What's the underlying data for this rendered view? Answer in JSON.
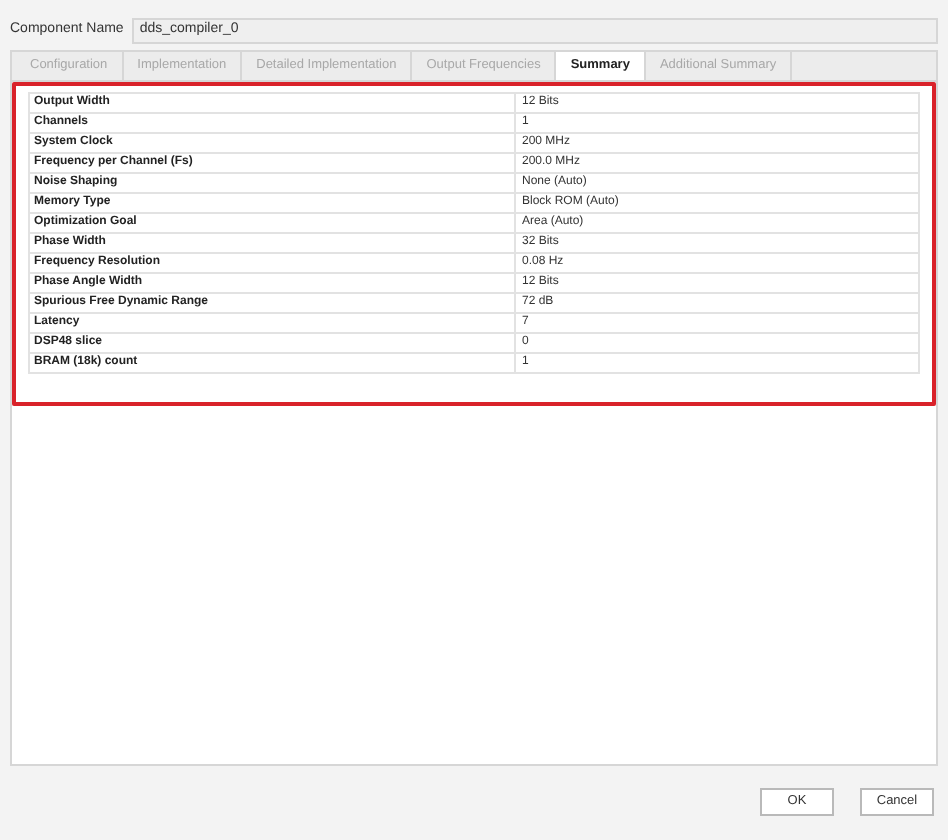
{
  "component_name": {
    "label": "Component Name",
    "value": "dds_compiler_0"
  },
  "tabs": [
    {
      "label": "Configuration",
      "selected": false
    },
    {
      "label": "Implementation",
      "selected": false
    },
    {
      "label": "Detailed Implementation",
      "selected": false
    },
    {
      "label": "Output Frequencies",
      "selected": false
    },
    {
      "label": "Summary",
      "selected": true
    },
    {
      "label": "Additional Summary",
      "selected": false
    }
  ],
  "summary_table": {
    "highlighted": true,
    "rows": [
      {
        "name": "Output Width",
        "value": "12 Bits"
      },
      {
        "name": "Channels",
        "value": "1"
      },
      {
        "name": "System Clock",
        "value": "200 MHz"
      },
      {
        "name": "Frequency per Channel (Fs)",
        "value": "200.0 MHz"
      },
      {
        "name": "Noise Shaping",
        "value": "None (Auto)"
      },
      {
        "name": "Memory Type",
        "value": "Block ROM (Auto)"
      },
      {
        "name": "Optimization Goal",
        "value": "Area (Auto)"
      },
      {
        "name": "Phase Width",
        "value": "32 Bits"
      },
      {
        "name": "Frequency Resolution",
        "value": "0.08 Hz"
      },
      {
        "name": "Phase Angle Width",
        "value": "12 Bits"
      },
      {
        "name": "Spurious Free Dynamic Range",
        "value": "72 dB"
      },
      {
        "name": "Latency",
        "value": "7"
      },
      {
        "name": "DSP48 slice",
        "value": "0"
      },
      {
        "name": "BRAM (18k) count",
        "value": "1"
      }
    ]
  },
  "buttons": [
    "OK",
    "Cancel"
  ]
}
